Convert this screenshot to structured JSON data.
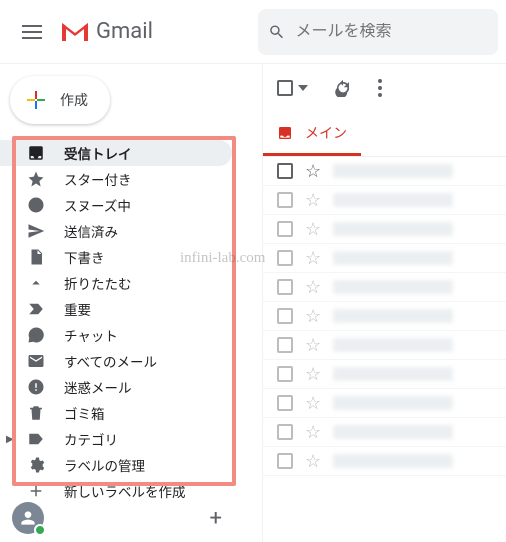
{
  "header": {
    "app_name": "Gmail",
    "search_placeholder": "メールを検索"
  },
  "compose_label": "作成",
  "sidebar": {
    "items": [
      {
        "label": "受信トレイ",
        "icon": "inbox",
        "active": true
      },
      {
        "label": "スター付き",
        "icon": "star"
      },
      {
        "label": "スヌーズ中",
        "icon": "clock"
      },
      {
        "label": "送信済み",
        "icon": "send"
      },
      {
        "label": "下書き",
        "icon": "draft"
      },
      {
        "label": "折りたたむ",
        "icon": "collapse"
      },
      {
        "label": "重要",
        "icon": "important"
      },
      {
        "label": "チャット",
        "icon": "chat"
      },
      {
        "label": "すべてのメール",
        "icon": "allmail"
      },
      {
        "label": "迷惑メール",
        "icon": "spam"
      },
      {
        "label": "ゴミ箱",
        "icon": "trash"
      },
      {
        "label": "カテゴリ",
        "icon": "label-expand"
      },
      {
        "label": "ラベルの管理",
        "icon": "gear"
      },
      {
        "label": "新しいラベルを作成",
        "icon": "plus"
      }
    ]
  },
  "main": {
    "tab_label": "メイン",
    "message_count": 11
  },
  "watermark": "infini-lab.com"
}
